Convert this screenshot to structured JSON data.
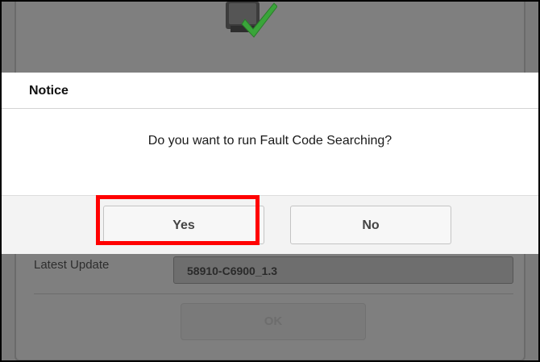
{
  "dialog": {
    "title": "Notice",
    "message": "Do you want to run Fault Code Searching?",
    "yes_label": "Yes",
    "no_label": "No"
  },
  "background": {
    "latest_update_label": "Latest Update",
    "latest_update_value": "58910-C6900_1.3",
    "ok_label": "OK",
    "device_icon": "ecu-device-check-icon"
  },
  "colors": {
    "highlight": "#ff0000",
    "checkmark": "#3aa53a",
    "overlay": "#7b7b7b"
  }
}
